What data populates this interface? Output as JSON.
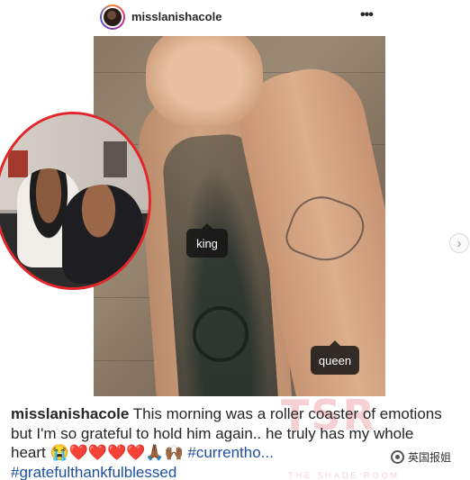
{
  "post": {
    "username": "misslanishacole",
    "more_icon": "more-horizontal-icon"
  },
  "photo": {
    "tags": [
      {
        "label": "king"
      },
      {
        "label": "queen"
      }
    ],
    "next_icon": "chevron-right-icon"
  },
  "caption": {
    "username": "misslanishacole",
    "text": "This morning was a roller coaster of emotions but I'm so grateful to hold him again.. he truly has my whole heart",
    "emojis": "😭❤️❤️❤️❤️🙏🏾🙌🏾",
    "hashtags": [
      "#currentho...",
      "#gratefulthankfulblessed"
    ]
  },
  "watermark": {
    "text": "TSR",
    "subtext": "THE SHADE ROOM"
  },
  "badge": {
    "icon": "wechat-channel-icon",
    "text": "英国报姐"
  },
  "colors": {
    "hashtag": "#1e4fa0",
    "inset_border": "#e2262b"
  }
}
